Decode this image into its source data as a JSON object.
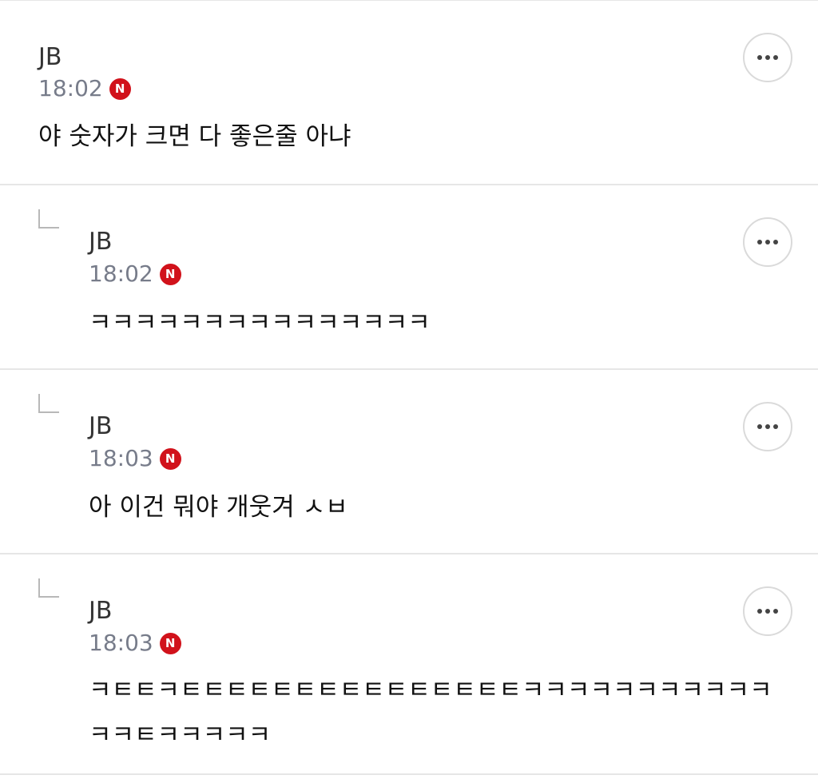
{
  "comments": [
    {
      "author": "JB",
      "time": "18:02",
      "badge": "N",
      "text": "야 숫자가 크면 다 좋은줄 아냐",
      "reply": false
    },
    {
      "author": "JB",
      "time": "18:02",
      "badge": "N",
      "text": "ㅋㅋㅋㅋㅋㅋㅋㅋㅋㅋㅋㅋㅋㅋㅋ",
      "reply": true
    },
    {
      "author": "JB",
      "time": "18:03",
      "badge": "N",
      "text": "아 이건 뭐야 개웃겨 ㅅㅂ",
      "reply": true
    },
    {
      "author": "JB",
      "time": "18:03",
      "badge": "N",
      "text": "ㅋㅌㅌㅋㅌㅌㅌㅌㅌㅌㅌㅌㅌㅌㅌㅌㅌㅌㅌㅋㅋㅋㅋㅋㅋㅋㅋㅋㅋㅋ\nㅋㅋㅌㅋㅋㅋㅋㅋ",
      "reply": true
    }
  ]
}
